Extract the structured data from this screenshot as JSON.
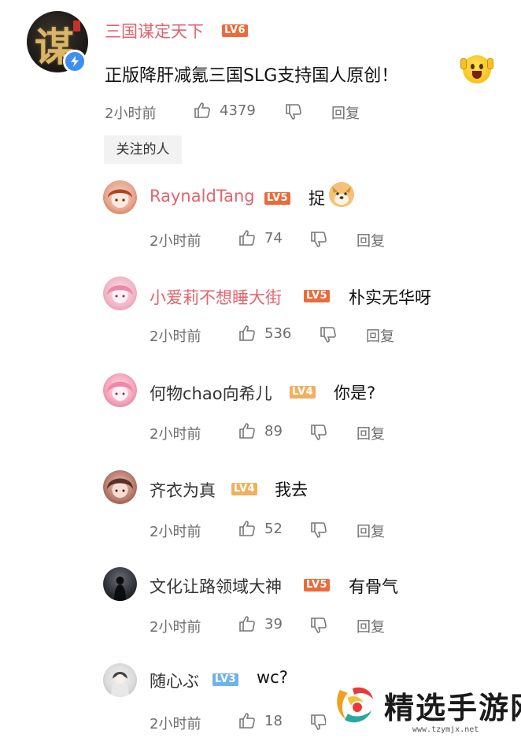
{
  "main_comment": {
    "username": "三国谋定天下",
    "level": "LV6",
    "text": "正版降肝减氪三国SLG支持国人原创！",
    "time": "2小时前",
    "likes": "4379",
    "reply_label": "回复",
    "avatar_glyph": "谋",
    "verified": true,
    "emoji": "scream-face"
  },
  "follow_tag": "关注的人",
  "replies": [
    {
      "username": "RaynaldTang",
      "level": "LV5",
      "text": "捉",
      "emoji": "doge",
      "time": "2小时前",
      "likes": "74",
      "reply_label": "回复",
      "name_color": "#e2646e",
      "level_color": "#ec6b3a"
    },
    {
      "username": "小爱莉不想睡大街",
      "level": "LV5",
      "text": "朴实无华呀",
      "time": "2小时前",
      "likes": "536",
      "reply_label": "回复",
      "name_color": "#e2646e",
      "level_color": "#ec6b3a"
    },
    {
      "username": "何物chao向希儿",
      "level": "LV4",
      "text": "你是?",
      "time": "2小时前",
      "likes": "89",
      "reply_label": "回复",
      "name_color": "#333333",
      "level_color": "#f0b060"
    },
    {
      "username": "齐衣为真",
      "level": "LV4",
      "text": "我去",
      "time": "2小时前",
      "likes": "52",
      "reply_label": "回复",
      "name_color": "#333333",
      "level_color": "#f0b060"
    },
    {
      "username": "文化让路领域大神",
      "level": "LV5",
      "text": "有骨气",
      "time": "2小时前",
      "likes": "39",
      "reply_label": "回复",
      "name_color": "#333333",
      "level_color": "#ec6b3a"
    },
    {
      "username": "随心ぶ",
      "level": "LV3",
      "text": "wc?",
      "time": "2小时前",
      "likes": "18",
      "reply_label": "回复",
      "name_color": "#333333",
      "level_color": "#6fb3e8"
    }
  ],
  "watermark": {
    "title": "精选手游网",
    "url": "www.tzymjx.net"
  },
  "colors": {
    "vip_name": "#e2646e",
    "meta_text": "#6e6e6e",
    "verify_blue": "#3d8ff0"
  }
}
